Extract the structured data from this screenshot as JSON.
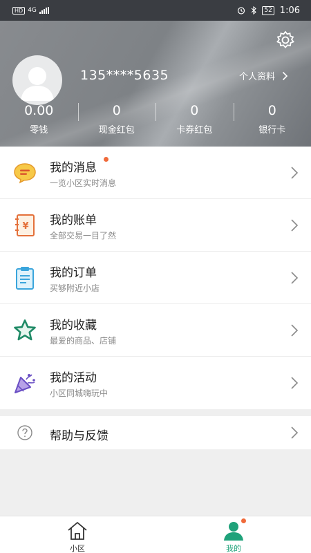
{
  "status_bar": {
    "left_badge": "HD",
    "signal": "4G",
    "battery": "52",
    "time": "1:06"
  },
  "profile": {
    "phone": "135****5635",
    "profile_link": "个人资料",
    "stats": [
      {
        "value": "0.00",
        "label": "零钱"
      },
      {
        "value": "0",
        "label": "现金红包"
      },
      {
        "value": "0",
        "label": "卡券红包"
      },
      {
        "value": "0",
        "label": "银行卡"
      }
    ]
  },
  "menu": [
    {
      "title": "我的消息",
      "subtitle": "一览小区实时消息",
      "icon": "message-icon",
      "has_dot": true
    },
    {
      "title": "我的账单",
      "subtitle": "全部交易一目了然",
      "icon": "bill-icon"
    },
    {
      "title": "我的订单",
      "subtitle": "买够附近小店",
      "icon": "order-icon"
    },
    {
      "title": "我的收藏",
      "subtitle": "最爱的商品、店铺",
      "icon": "star-icon"
    },
    {
      "title": "我的活动",
      "subtitle": "小区同城嗨玩中",
      "icon": "party-icon"
    }
  ],
  "help": {
    "title": "帮助与反馈",
    "icon": "help-icon"
  },
  "tabbar": [
    {
      "label": "小区",
      "icon": "home-icon"
    },
    {
      "label": "我的",
      "icon": "person-icon",
      "active": true
    }
  ],
  "colors": {
    "accent": "#1fa27a",
    "notification_dot": "#f06a3a",
    "header_gray": "#85898d"
  }
}
